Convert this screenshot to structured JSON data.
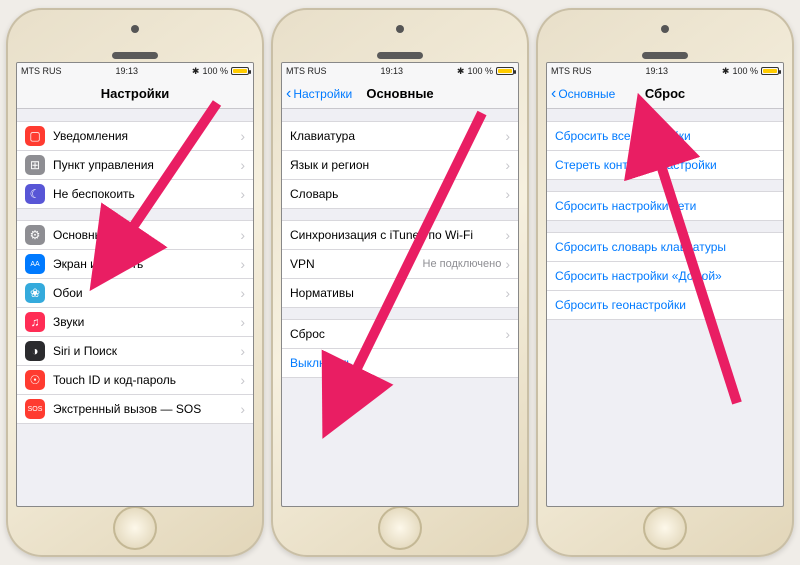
{
  "status": {
    "carrier": "MTS RUS",
    "time": "19:13",
    "battery": "100 %"
  },
  "phone1": {
    "title": "Настройки",
    "rows": [
      {
        "icon": "ic-red",
        "glyph": "▢",
        "label": "Уведомления"
      },
      {
        "icon": "ic-gray",
        "glyph": "⊞",
        "label": "Пункт управления"
      },
      {
        "icon": "ic-purple",
        "glyph": "☾",
        "label": "Не беспокоить"
      }
    ],
    "rows2": [
      {
        "icon": "ic-gray",
        "glyph": "⚙",
        "label": "Основные"
      },
      {
        "icon": "ic-blue",
        "glyph": "AA",
        "label": "Экран и яркость"
      },
      {
        "icon": "ic-cyan",
        "glyph": "❀",
        "label": "Обои"
      },
      {
        "icon": "ic-pink",
        "glyph": "♫",
        "label": "Звуки"
      },
      {
        "icon": "ic-dark",
        "glyph": "◑",
        "label": "Siri и Поиск"
      },
      {
        "icon": "ic-red",
        "glyph": "☉",
        "label": "Touch ID и код-пароль"
      },
      {
        "icon": "ic-orange",
        "glyph": "SOS",
        "label": "Экстренный вызов — SOS"
      }
    ]
  },
  "phone2": {
    "back": "Настройки",
    "title": "Основные",
    "g1": [
      {
        "label": "Клавиатура"
      },
      {
        "label": "Язык и регион"
      },
      {
        "label": "Словарь"
      }
    ],
    "g2": [
      {
        "label": "Синхронизация с iTunes по Wi-Fi"
      },
      {
        "label": "VPN",
        "value": "Не подключено"
      },
      {
        "label": "Нормативы"
      }
    ],
    "g3": [
      {
        "label": "Сброс"
      },
      {
        "label": "Выключить",
        "blue": true,
        "nodisc": true
      }
    ]
  },
  "phone3": {
    "back": "Основные",
    "title": "Сброс",
    "g1": [
      {
        "label": "Сбросить все настройки"
      },
      {
        "label": "Стереть контент и настройки"
      }
    ],
    "g2": [
      {
        "label": "Сбросить настройки сети"
      }
    ],
    "g3": [
      {
        "label": "Сбросить словарь клавиатуры"
      },
      {
        "label": "Сбросить настройки «Домой»"
      },
      {
        "label": "Сбросить геонастройки"
      }
    ]
  }
}
